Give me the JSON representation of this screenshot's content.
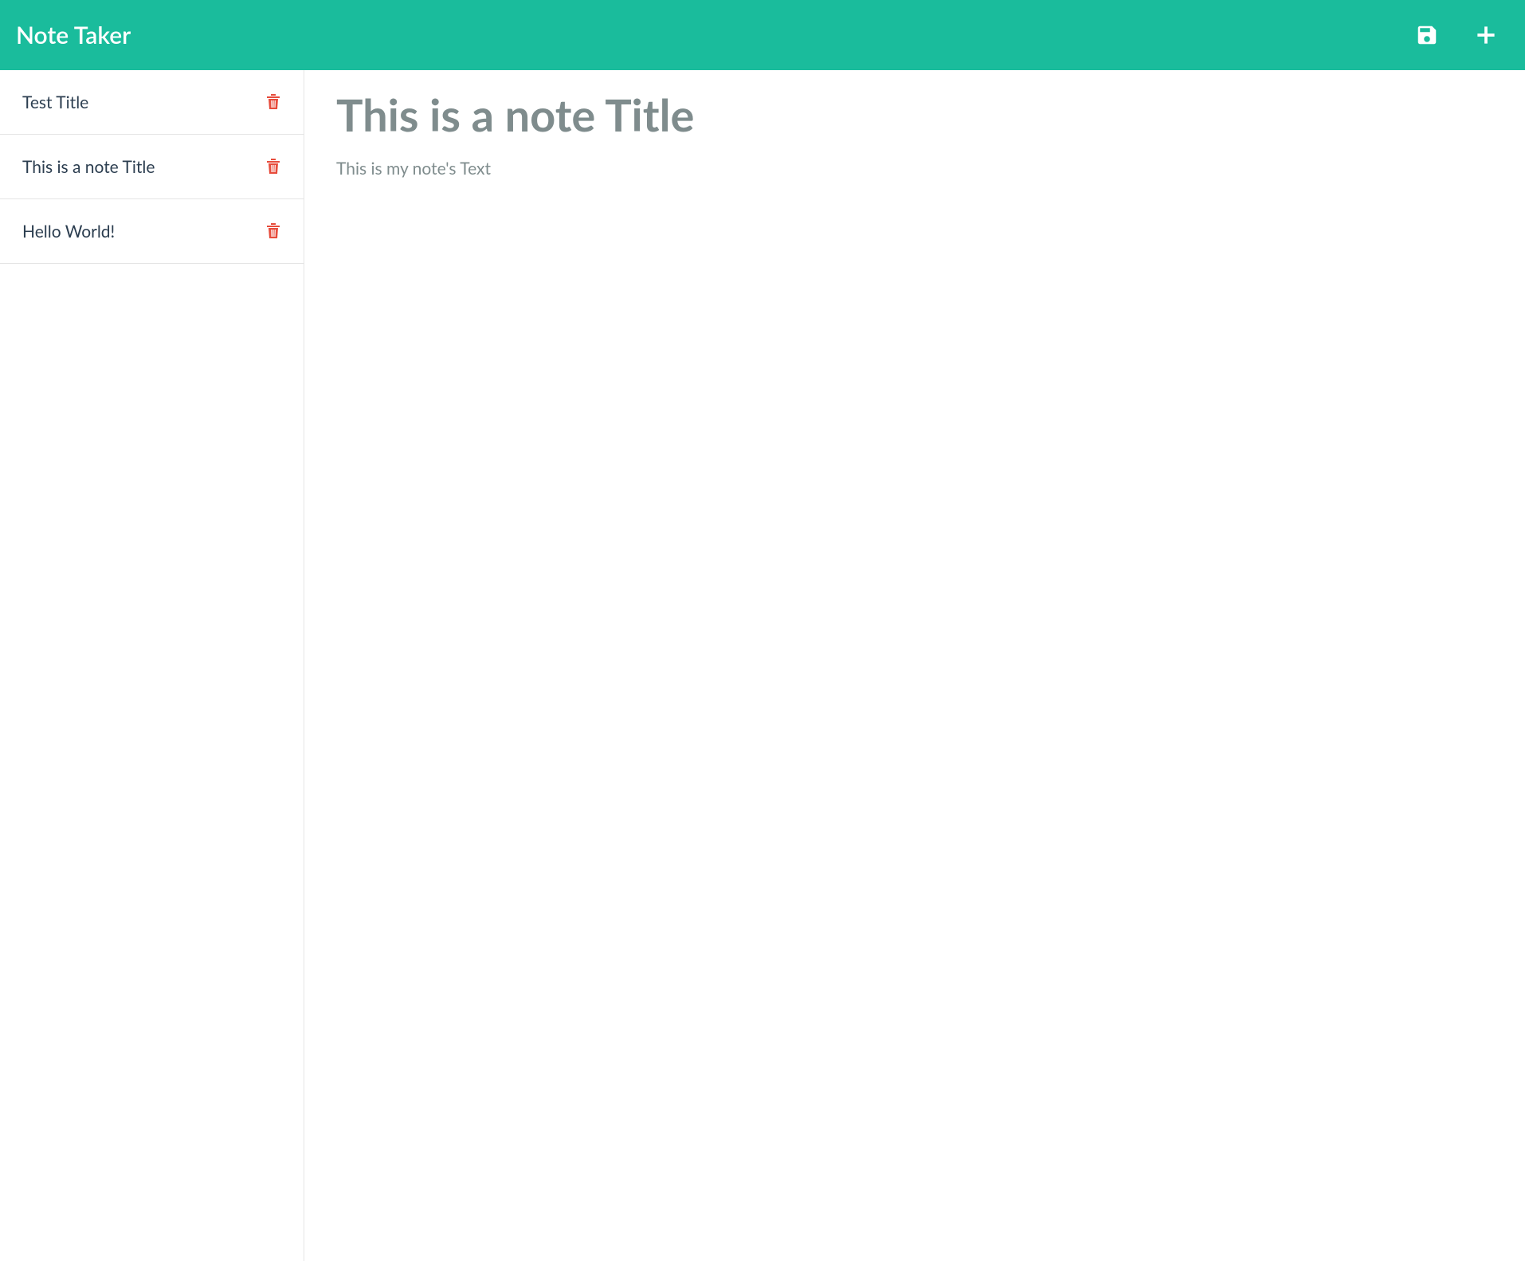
{
  "header": {
    "app_title": "Note Taker"
  },
  "icons": {
    "save": "save-icon",
    "add": "plus-icon",
    "delete": "trash-icon"
  },
  "colors": {
    "accent": "#1abc9c",
    "danger": "#e74c3c",
    "muted_text": "#7f8c8d",
    "body_text": "#2c3e50",
    "border": "#e5e5e5"
  },
  "sidebar": {
    "notes": [
      {
        "title": "Test Title"
      },
      {
        "title": "This is a note Title"
      },
      {
        "title": "Hello World!"
      }
    ]
  },
  "editor": {
    "title_value": "This is a note Title",
    "body_value": "This is my note's Text"
  }
}
